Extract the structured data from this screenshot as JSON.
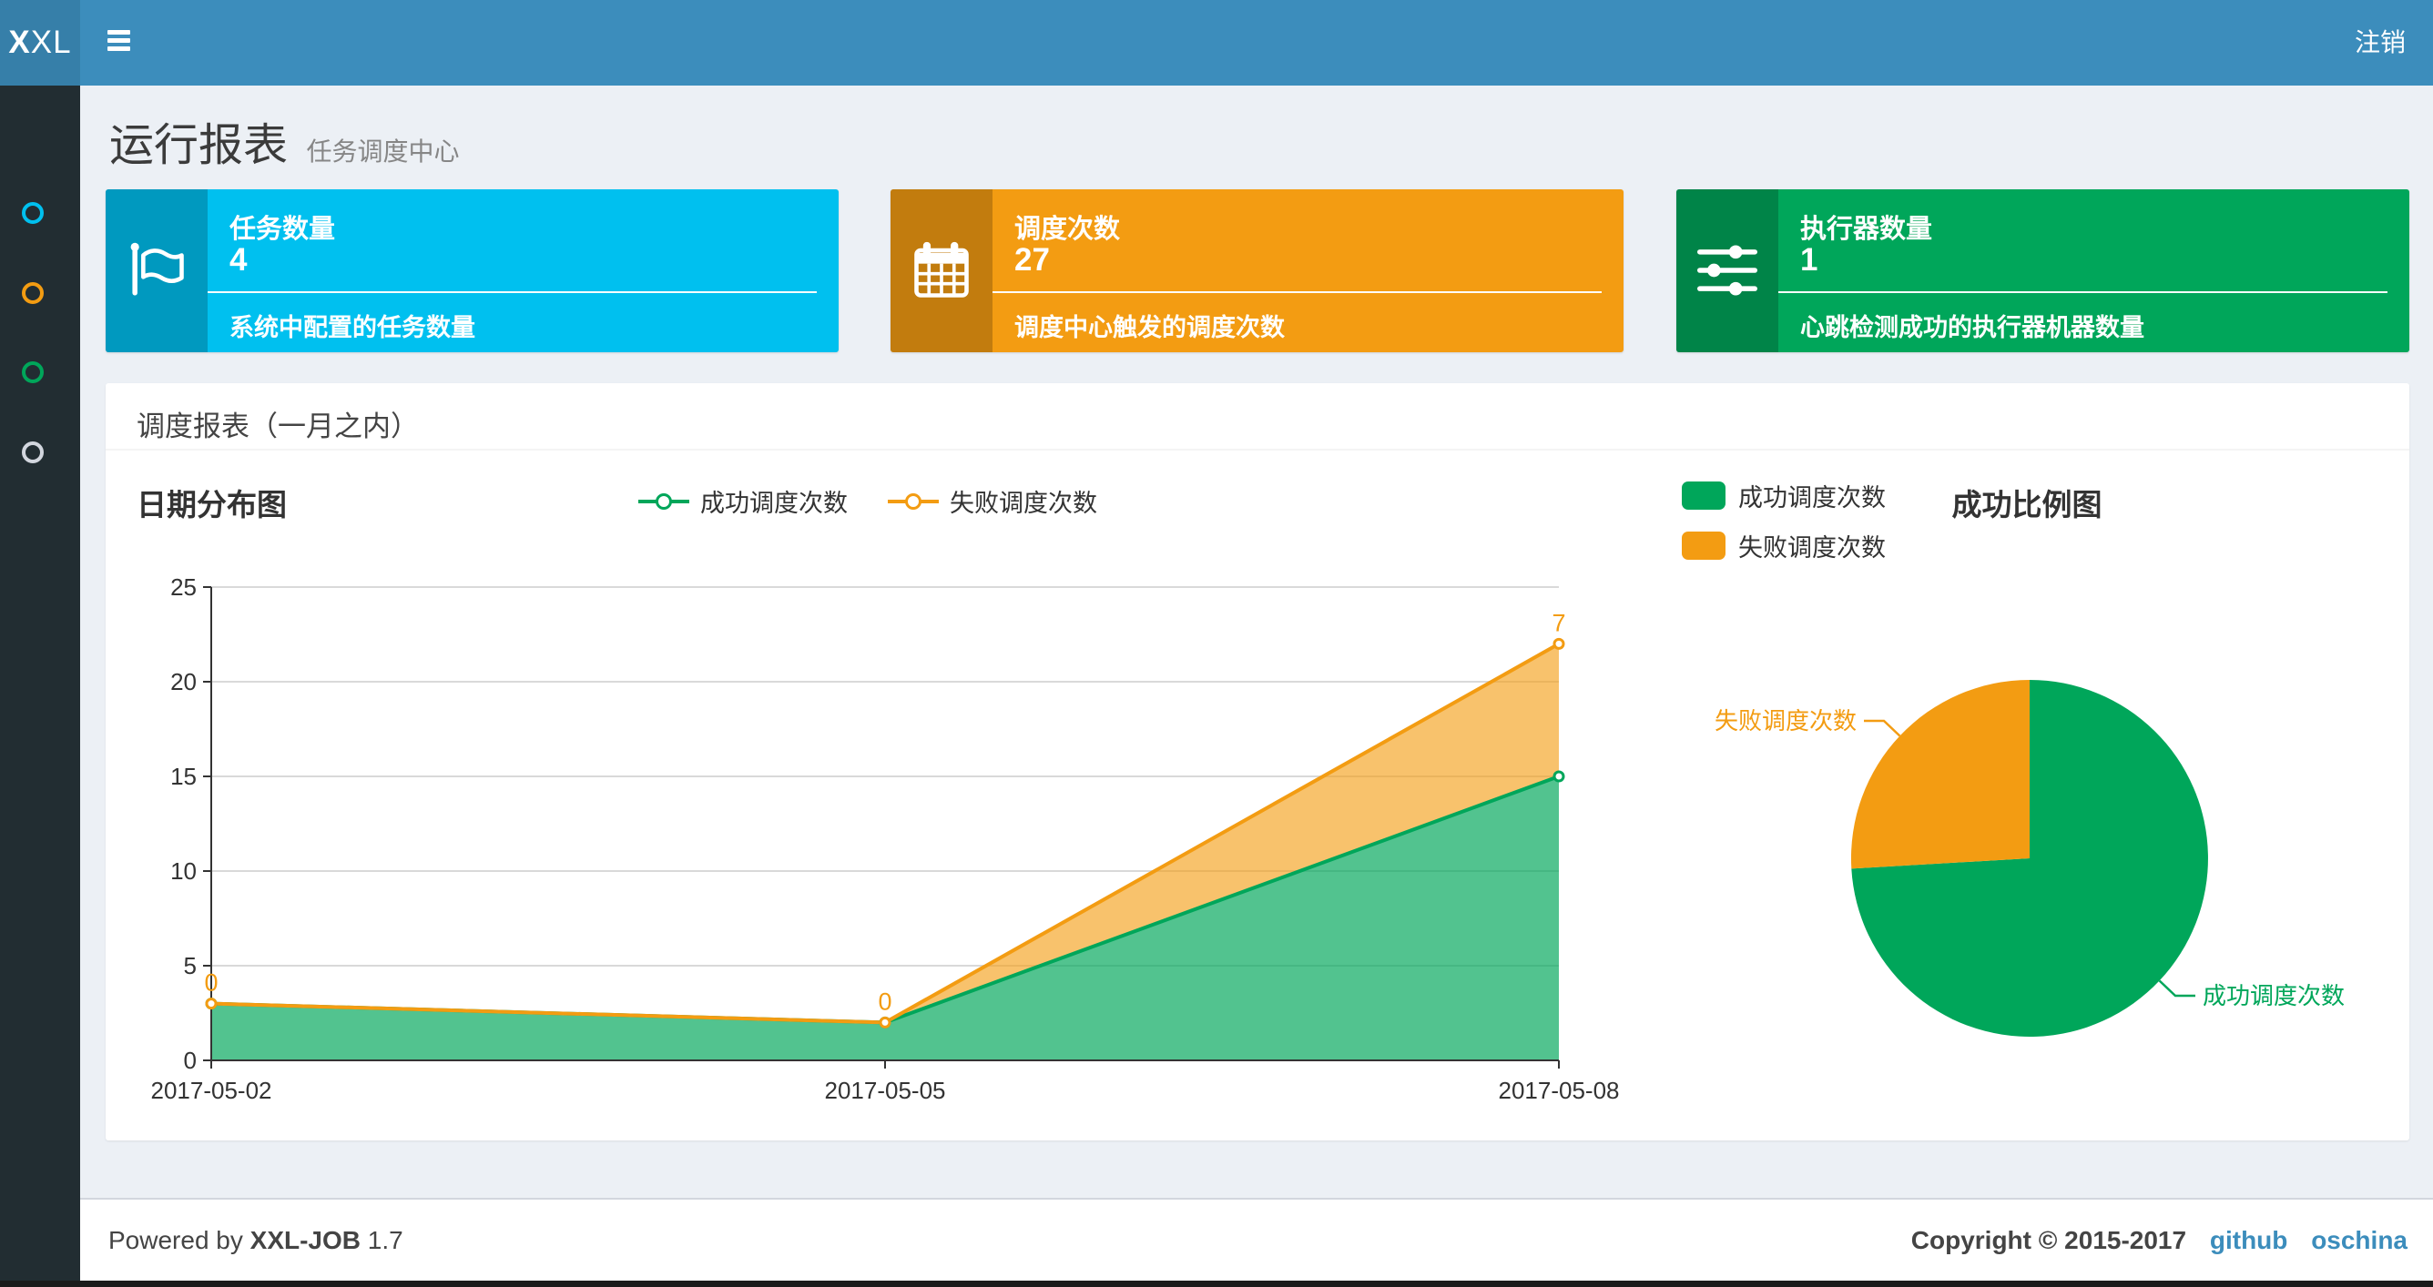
{
  "header": {
    "logo_text": "XXL",
    "logout_label": "注销",
    "bar_color": "#3c8dbc",
    "logo_bg": "#367fa9"
  },
  "sidebar": {
    "bg": "#222d32",
    "items": [
      {
        "icon": "circle-icon",
        "color": "#00c0ef"
      },
      {
        "icon": "circle-icon",
        "color": "#f39c12"
      },
      {
        "icon": "circle-icon",
        "color": "#00a65a"
      },
      {
        "icon": "circle-icon",
        "color": "#d2d6de"
      }
    ]
  },
  "page": {
    "title": "运行报表",
    "subtitle": "任务调度中心"
  },
  "stats": [
    {
      "title": "任务数量",
      "value": "4",
      "desc": "系统中配置的任务数量",
      "color": "#00c0ef",
      "icon": "flag-icon"
    },
    {
      "title": "调度次数",
      "value": "27",
      "desc": "调度中心触发的调度次数",
      "color": "#f39c12",
      "icon": "calendar-icon"
    },
    {
      "title": "执行器数量",
      "value": "1",
      "desc": "心跳检测成功的执行器机器数量",
      "color": "#00a65a",
      "icon": "sliders-icon"
    }
  ],
  "panel": {
    "title": "调度报表（一月之内）"
  },
  "chart_data": [
    {
      "type": "area",
      "title": "日期分布图",
      "stacked": true,
      "x": [
        "2017-05-02",
        "2017-05-05",
        "2017-05-08"
      ],
      "series": [
        {
          "name": "成功调度次数",
          "color": "#00a65a",
          "values": [
            3,
            2,
            15
          ]
        },
        {
          "name": "失败调度次数",
          "color": "#f39c12",
          "values": [
            0,
            0,
            7
          ],
          "point_labels": [
            "0",
            "0",
            "7"
          ]
        }
      ],
      "ylim": [
        0,
        25
      ],
      "yticks": [
        0,
        5,
        10,
        15,
        20,
        25
      ],
      "grid": true,
      "legend_position": "top-center"
    },
    {
      "type": "pie",
      "title": "成功比例图",
      "slices": [
        {
          "name": "成功调度次数",
          "value": 20,
          "color": "#00a65a"
        },
        {
          "name": "失败调度次数",
          "value": 7,
          "color": "#f39c12"
        }
      ],
      "legend_position": "top-left"
    }
  ],
  "footer": {
    "powered_prefix": "Powered by",
    "product": "XXL-JOB",
    "version": "1.7",
    "copyright": "Copyright © 2015-2017",
    "links": [
      {
        "label": "github"
      },
      {
        "label": "oschina"
      }
    ]
  }
}
